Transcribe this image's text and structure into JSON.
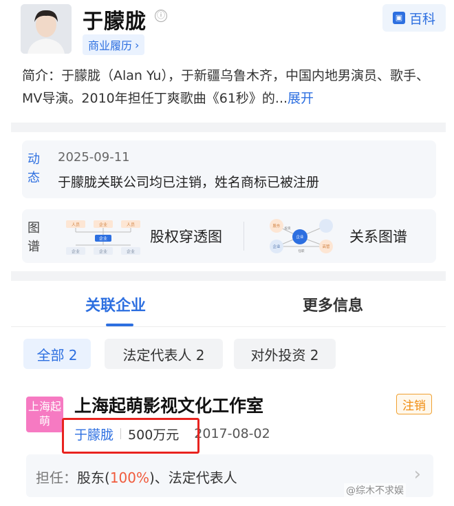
{
  "profile": {
    "name": "于朦胧",
    "info_icon": "ⓘ",
    "baike_label": "百科",
    "business_tag": "商业履历",
    "bio": "简介：于朦胧（Alan Yu），于新疆乌鲁木齐，中国内地男演员、歌手、MV导演。2010年担任丁爽歌曲《61秒》的...",
    "bio_expand": "展开"
  },
  "news": {
    "tag": "动态",
    "date": "2025-09-11",
    "headline": "于朦胧关联公司均已注销，姓名商标已被注册"
  },
  "graphs": {
    "tag": "图谱",
    "equity_label": "股权穿透图",
    "relation_label": "关系图谱",
    "equity_thumb": {
      "person": "人员",
      "company": "企业"
    },
    "relation_thumb": {
      "nodes": [
        "股东",
        "企业",
        "企业",
        "高管"
      ],
      "edges": [
        "投资",
        "任职"
      ]
    }
  },
  "tabs": [
    {
      "label": "关联企业",
      "active": true
    },
    {
      "label": "更多信息",
      "active": false
    }
  ],
  "filters": [
    {
      "label": "全部 2",
      "active": true
    },
    {
      "label": "法定代表人 2",
      "active": false
    },
    {
      "label": "对外投资 2",
      "active": false
    }
  ],
  "company": {
    "logo_text": "上海起萌",
    "logo_color": "#f67ac2",
    "name": "上海起萌影视文化工作室",
    "status": "注销",
    "legal_rep": "于朦胧",
    "capital": "500万元",
    "founded": "2017-08-02",
    "role_label": "担任：",
    "role_prefix": "股东(",
    "role_pct": "100%",
    "role_suffix": ")、法定代表人"
  },
  "watermark": "@综木不求娱",
  "colors": {
    "accent": "#2d6fe0",
    "highlight": "#e8231f",
    "status_orange": "#f08c10"
  }
}
